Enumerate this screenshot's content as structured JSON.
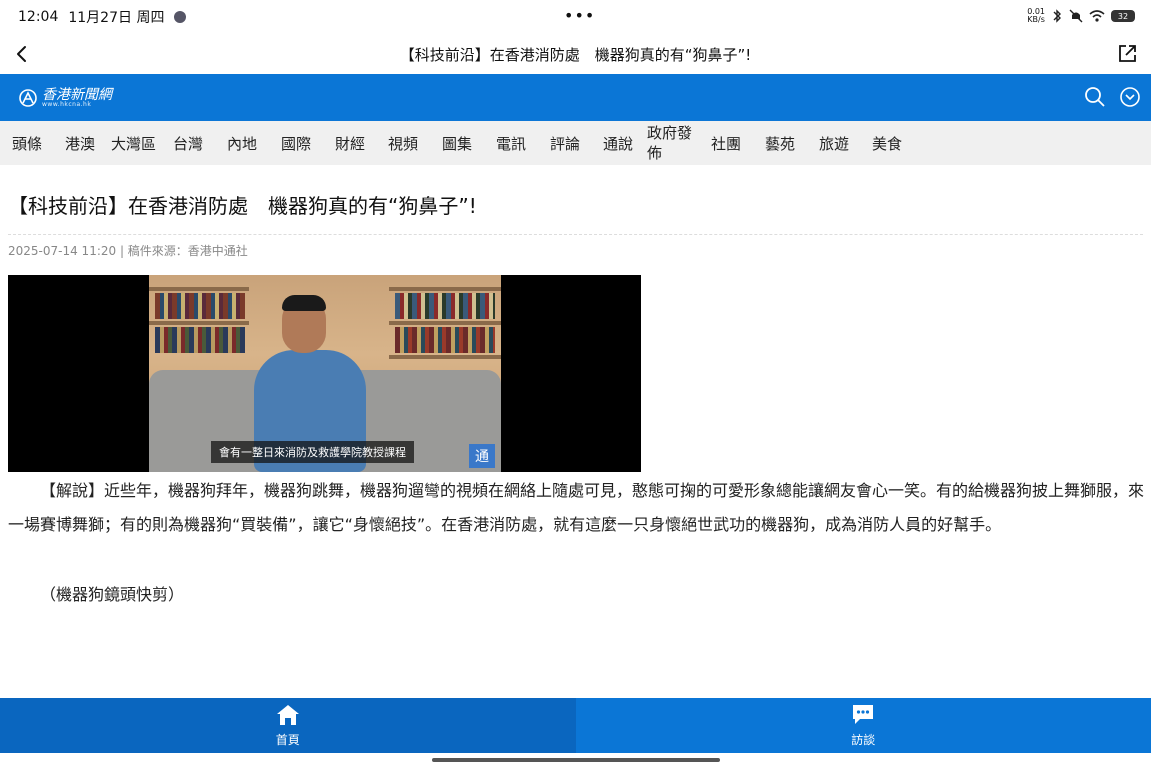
{
  "status_bar": {
    "time": "12:04",
    "date": "11月27日 周四",
    "speed_value": "0.01",
    "speed_unit": "KB/s",
    "battery": "32"
  },
  "nav": {
    "title": "【科技前沿】在香港消防處　機器狗真的有“狗鼻子”!"
  },
  "banner": {
    "logo_text": "香港新聞網",
    "logo_url": "www.hkcna.hk",
    "brand_color": "#0b76d6"
  },
  "categories": [
    "頭條",
    "港澳",
    "大灣區",
    "台灣",
    "內地",
    "國際",
    "財經",
    "視頻",
    "圖集",
    "電訊",
    "評論",
    "通說",
    "政府發佈",
    "社團",
    "藝苑",
    "旅遊",
    "美食"
  ],
  "article": {
    "title": "【科技前沿】在香港消防處　機器狗真的有“狗鼻子”!",
    "meta": "2025-07-14 11:20 | 稿件來源：香港中通社",
    "video_subtitle": "會有一整日來消防及救護學院教授課程",
    "video_watermark": "通",
    "paragraphs": [
      "【解說】近些年，機器狗拜年，機器狗跳舞，機器狗遛彎的視頻在網絡上隨處可見，憨態可掬的可愛形象總能讓網友會心一笑。有的給機器狗披上舞獅服，來一場賽博舞獅；有的則為機器狗“買裝備”，讓它“身懷絕技”。在香港消防處，就有這麼一只身懷絕世武功的機器狗，成為消防人員的好幫手。",
      "（機器狗鏡頭快剪）"
    ]
  },
  "tabbar": {
    "home_label": "首頁",
    "talk_label": "訪談"
  }
}
